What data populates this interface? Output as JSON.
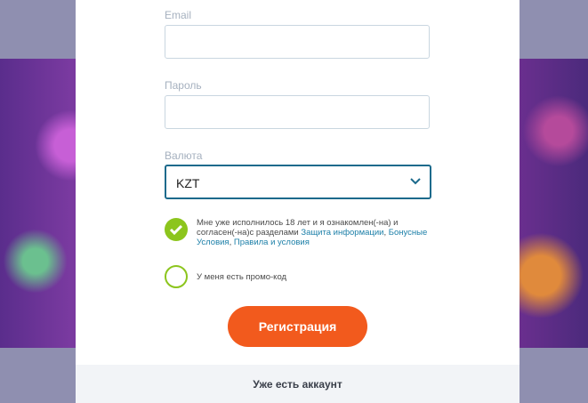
{
  "form": {
    "email_label": "Email",
    "password_label": "Пароль",
    "currency_label": "Валюта",
    "currency_value": "KZT",
    "agree_text": "Мне уже исполнилось 18 лет и я ознакомлен(-на) и согласен(-на)с разделами ",
    "agree_link_1": "Защита информации",
    "agree_sep_1": ", ",
    "agree_link_2": "Бонусные Условия",
    "agree_sep_2": ", ",
    "agree_link_3": "Правила и условия",
    "promo_label": "У меня есть промо-код",
    "register_label": "Регистрация"
  },
  "footer": {
    "login_link": "Уже есть аккаунт"
  },
  "colors": {
    "accent_button": "#f25a1d",
    "checkbox": "#8cc51d",
    "select_border": "#1c6a8c",
    "link": "#1c7fa8"
  },
  "checkboxes": {
    "agree_checked": true,
    "promo_checked": false
  }
}
